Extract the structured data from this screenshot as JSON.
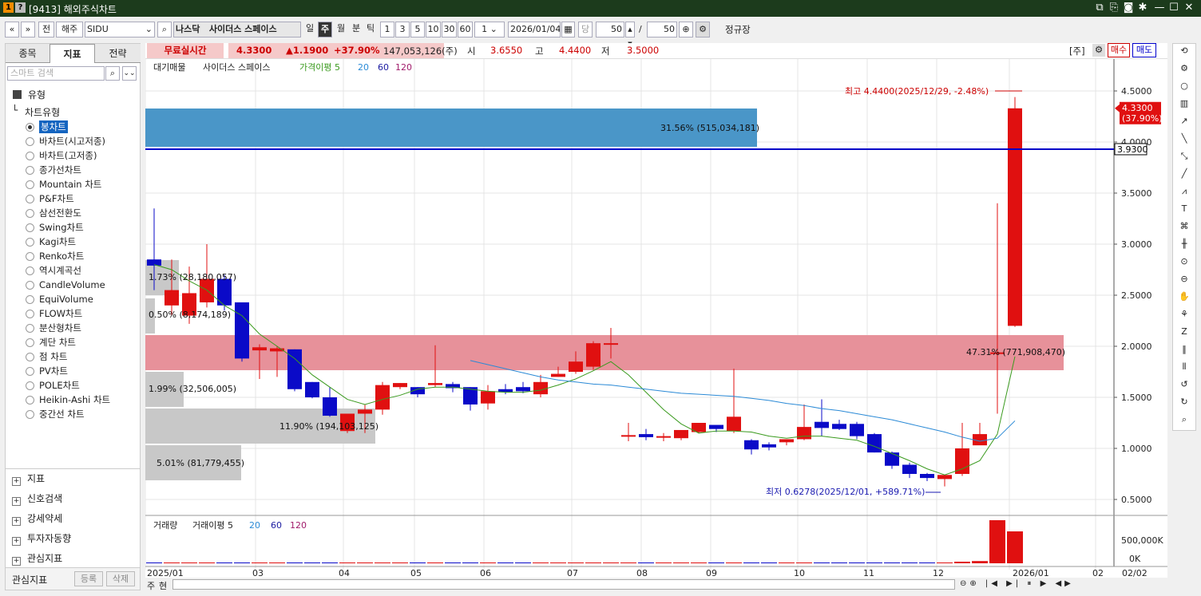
{
  "window": {
    "title": "[9413] 해외주식차트"
  },
  "toolbar": {
    "nav_prev": "«",
    "nav_dropdown": "»",
    "jeon": "전",
    "market": "해주",
    "symbol": "SIDU",
    "exchange": "나스닥",
    "name": "사이더스 스페이스",
    "periods": [
      "일",
      "주",
      "월",
      "분",
      "틱"
    ],
    "selected_period": "주",
    "minutes": [
      "1",
      "3",
      "5",
      "10",
      "30",
      "60"
    ],
    "step": "1",
    "date": "2026/01/04",
    "dang": "당",
    "count": "50",
    "slash": "/",
    "count2": "50",
    "regular_label": "정규장"
  },
  "left_panel": {
    "tabs": [
      "종목",
      "지표",
      "전략"
    ],
    "active_tab": "지표",
    "search_placeholder": "스마트 검색",
    "tree_root": "유형",
    "tree_child": "차트유형",
    "chart_types": [
      "봉차트",
      "바차트(시고저종)",
      "바차트(고저종)",
      "종가선차트",
      "Mountain 차트",
      "P&F차트",
      "삼선전환도",
      "Swing차트",
      "Kagi차트",
      "Renko차트",
      "역시계곡선",
      "CandleVolume",
      "EquiVolume",
      "FLOW차트",
      "분산형차트",
      "계단 차트",
      "점 차트",
      "PV차트",
      "POLE차트",
      "Heikin-Ashi 차트",
      "중간선 차트"
    ],
    "selected_type": "봉차트",
    "sections": [
      "지표",
      "신호검색",
      "강세약세",
      "투자자동향",
      "관심지표"
    ],
    "footer_label": "관심지표",
    "footer_btn1": "등록",
    "footer_btn2": "삭제"
  },
  "infobar": {
    "realtime": "무료실시간",
    "price": "4.3300",
    "change": "▲1.1900",
    "pct": "+37.90%",
    "volume": "147,053,126(주)",
    "open_label": "시",
    "open": "3.6550",
    "high_label": "고",
    "high": "4.4400",
    "low_label": "저",
    "low": "3.5000",
    "unit": "[주]",
    "buy": "매수",
    "sell": "매도"
  },
  "chart_data": {
    "type": "candlestick",
    "legend_price": [
      "대기매물",
      "사이더스 스페이스",
      "가격이평 5",
      "20",
      "60",
      "120"
    ],
    "legend_volume": [
      "거래량",
      "거래이평 5",
      "20",
      "60",
      "120"
    ],
    "y_ticks": [
      "4.5000",
      "4.0000",
      "3.5000",
      "3.0000",
      "2.5000",
      "2.0000",
      "1.5000",
      "1.0000",
      "0.5000"
    ],
    "y_range": [
      0.5,
      4.5
    ],
    "x_ticks": [
      "2025/01",
      "03",
      "04",
      "05",
      "06",
      "07",
      "08",
      "09",
      "10",
      "11",
      "12",
      "2026/01",
      "02",
      "02/02"
    ],
    "current_price_tag": "4.3300",
    "current_pct_tag": "(37.90%)",
    "hline_value": "3.9300",
    "max_label": "최고 4.4400(2025/12/29, -2.48%)",
    "min_label": "최저 0.6278(2025/12/01, +589.71%)",
    "volume_ticks": [
      "500,000K",
      "0K"
    ],
    "candles": [
      {
        "o": 2.85,
        "h": 3.35,
        "l": 2.55,
        "c": 2.79
      },
      {
        "o": 2.4,
        "h": 2.85,
        "l": 2.3,
        "c": 2.55
      },
      {
        "o": 2.3,
        "h": 2.78,
        "l": 2.22,
        "c": 2.52
      },
      {
        "o": 2.43,
        "h": 3.0,
        "l": 2.38,
        "c": 2.66
      },
      {
        "o": 2.66,
        "h": 2.7,
        "l": 2.35,
        "c": 2.4
      },
      {
        "o": 2.43,
        "h": 2.43,
        "l": 1.85,
        "c": 1.88
      },
      {
        "o": 1.96,
        "h": 2.02,
        "l": 1.68,
        "c": 1.99
      },
      {
        "o": 1.95,
        "h": 2.0,
        "l": 1.7,
        "c": 1.98
      },
      {
        "o": 1.97,
        "h": 1.97,
        "l": 1.56,
        "c": 1.58
      },
      {
        "o": 1.65,
        "h": 1.65,
        "l": 1.49,
        "c": 1.5
      },
      {
        "o": 1.5,
        "h": 1.6,
        "l": 1.31,
        "c": 1.32
      },
      {
        "o": 1.17,
        "h": 1.33,
        "l": 1.15,
        "c": 1.34
      },
      {
        "o": 1.34,
        "h": 1.43,
        "l": 1.15,
        "c": 1.38
      },
      {
        "o": 1.38,
        "h": 1.65,
        "l": 1.33,
        "c": 1.62
      },
      {
        "o": 1.6,
        "h": 1.64,
        "l": 1.58,
        "c": 1.64
      },
      {
        "o": 1.6,
        "h": 1.6,
        "l": 1.5,
        "c": 1.53
      },
      {
        "o": 1.62,
        "h": 2.01,
        "l": 1.6,
        "c": 1.64
      },
      {
        "o": 1.63,
        "h": 1.65,
        "l": 1.55,
        "c": 1.59
      },
      {
        "o": 1.6,
        "h": 1.6,
        "l": 1.37,
        "c": 1.43
      },
      {
        "o": 1.44,
        "h": 1.62,
        "l": 1.38,
        "c": 1.56
      },
      {
        "o": 1.58,
        "h": 1.63,
        "l": 1.53,
        "c": 1.55
      },
      {
        "o": 1.6,
        "h": 1.65,
        "l": 1.54,
        "c": 1.56
      },
      {
        "o": 1.53,
        "h": 1.72,
        "l": 1.5,
        "c": 1.65
      },
      {
        "o": 1.7,
        "h": 1.8,
        "l": 1.7,
        "c": 1.73
      },
      {
        "o": 1.75,
        "h": 1.95,
        "l": 1.73,
        "c": 1.85
      },
      {
        "o": 1.8,
        "h": 2.05,
        "l": 1.77,
        "c": 2.03
      },
      {
        "o": 2.03,
        "h": 2.18,
        "l": 1.88,
        "c": 2.03
      },
      {
        "o": 1.13,
        "h": 1.25,
        "l": 1.07,
        "c": 1.13
      },
      {
        "o": 1.14,
        "h": 1.19,
        "l": 1.08,
        "c": 1.11
      },
      {
        "o": 1.11,
        "h": 1.15,
        "l": 1.07,
        "c": 1.12
      },
      {
        "o": 1.1,
        "h": 1.16,
        "l": 1.08,
        "c": 1.18
      },
      {
        "o": 1.16,
        "h": 1.25,
        "l": 1.15,
        "c": 1.25
      },
      {
        "o": 1.23,
        "h": 1.21,
        "l": 1.16,
        "c": 1.19
      },
      {
        "o": 1.17,
        "h": 1.78,
        "l": 1.15,
        "c": 1.31
      },
      {
        "o": 1.08,
        "h": 1.09,
        "l": 0.94,
        "c": 0.99
      },
      {
        "o": 1.04,
        "h": 1.06,
        "l": 0.98,
        "c": 1.01
      },
      {
        "o": 1.06,
        "h": 1.09,
        "l": 1.03,
        "c": 1.09
      },
      {
        "o": 1.09,
        "h": 1.43,
        "l": 1.08,
        "c": 1.21
      },
      {
        "o": 1.26,
        "h": 1.48,
        "l": 1.12,
        "c": 1.2
      },
      {
        "o": 1.24,
        "h": 1.28,
        "l": 1.18,
        "c": 1.19
      },
      {
        "o": 1.24,
        "h": 1.26,
        "l": 1.09,
        "c": 1.12
      },
      {
        "o": 1.14,
        "h": 1.15,
        "l": 0.96,
        "c": 0.96
      },
      {
        "o": 0.96,
        "h": 0.97,
        "l": 0.8,
        "c": 0.83
      },
      {
        "o": 0.84,
        "h": 0.86,
        "l": 0.71,
        "c": 0.75
      },
      {
        "o": 0.75,
        "h": 0.76,
        "l": 0.68,
        "c": 0.71
      },
      {
        "o": 0.7,
        "h": 0.74,
        "l": 0.6278,
        "c": 0.74
      },
      {
        "o": 0.75,
        "h": 1.25,
        "l": 0.73,
        "c": 1.0
      },
      {
        "o": 1.03,
        "h": 1.25,
        "l": 1.04,
        "c": 1.14
      },
      {
        "o": 1.94,
        "h": 3.4,
        "l": 1.34,
        "c": 1.94
      },
      {
        "o": 2.2,
        "h": 4.44,
        "l": 2.19,
        "c": 4.33
      }
    ],
    "ma5": [
      2.8,
      2.75,
      2.64,
      2.55,
      2.4,
      2.3,
      2.12,
      2.0,
      1.88,
      1.72,
      1.6,
      1.48,
      1.43,
      1.48,
      1.52,
      1.58,
      1.6,
      1.6,
      1.58,
      1.56,
      1.55,
      1.55,
      1.57,
      1.62,
      1.68,
      1.76,
      1.85,
      1.72,
      1.55,
      1.38,
      1.24,
      1.15,
      1.17,
      1.17,
      1.16,
      1.12,
      1.1,
      1.12,
      1.12,
      1.1,
      1.08,
      1.02,
      0.95,
      0.88,
      0.8,
      0.74,
      0.8,
      0.88,
      1.14,
      1.9
    ],
    "ma20": [
      null,
      null,
      null,
      null,
      null,
      null,
      null,
      null,
      null,
      null,
      null,
      null,
      null,
      null,
      null,
      null,
      null,
      null,
      1.86,
      1.82,
      1.78,
      1.74,
      1.7,
      1.67,
      1.65,
      1.63,
      1.62,
      1.6,
      1.58,
      1.56,
      1.54,
      1.53,
      1.52,
      1.51,
      1.49,
      1.47,
      1.44,
      1.42,
      1.39,
      1.37,
      1.34,
      1.31,
      1.28,
      1.24,
      1.2,
      1.16,
      1.11,
      1.07,
      1.1,
      1.27
    ],
    "overlay_bars": [
      {
        "label": "31.56% (515,034,181)"
      },
      {
        "label": "1.73% (28,180,057)"
      },
      {
        "label": "0.50% (8,174,189)"
      },
      {
        "label": "47.31% (771,908,470)"
      },
      {
        "label": "1.99% (32,506,005)"
      },
      {
        "label": "11.90% (194,103,125)"
      },
      {
        "label": "5.01% (81,779,455)"
      }
    ],
    "volumes_k": [
      5,
      4,
      4,
      5,
      6,
      6,
      5,
      5,
      4,
      5,
      5,
      4,
      4,
      5,
      4,
      4,
      5,
      4,
      4,
      4,
      4,
      4,
      5,
      6,
      6,
      8,
      8,
      5,
      4,
      4,
      4,
      4,
      4,
      8,
      4,
      4,
      4,
      6,
      5,
      4,
      4,
      5,
      6,
      6,
      5,
      8,
      20,
      28,
      540,
      400
    ]
  },
  "statusbar": {
    "left1": "주",
    "left2": "현"
  },
  "colors": {
    "up": "#e01010",
    "down": "#0a0ac8",
    "ma5": "#3a9a1e",
    "ma20": "#2b8ad6",
    "hline": "#0000c8"
  }
}
